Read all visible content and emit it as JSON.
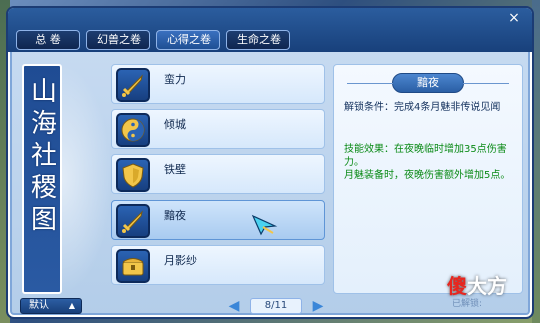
{
  "tabs": [
    {
      "label": "总  卷",
      "active": false
    },
    {
      "label": "幻兽之卷",
      "active": false
    },
    {
      "label": "心得之卷",
      "active": true
    },
    {
      "label": "生命之卷",
      "active": false
    }
  ],
  "close_icon": "×",
  "banner": {
    "text": "山海社稷图"
  },
  "list": {
    "items": [
      {
        "label": "蛮力",
        "icon": "sword-icon",
        "selected": false
      },
      {
        "label": "倾城",
        "icon": "yin-yang-icon",
        "selected": false
      },
      {
        "label": "铁壁",
        "icon": "shield-icon",
        "selected": false
      },
      {
        "label": "黯夜",
        "icon": "sword-icon",
        "selected": true
      },
      {
        "label": "月影纱",
        "icon": "chest-icon",
        "selected": false
      }
    ]
  },
  "detail": {
    "title": "黯夜",
    "unlock_text": "解锁条件：完成4条月魅非传说见闻",
    "effect_line1": "技能效果：在夜晚临时增加35点伤害力。",
    "effect_line2": "月魅装备时，夜晚伤害额外增加5点。"
  },
  "footer": {
    "default_label": "默认",
    "default_arrow": "▲",
    "page_indicator": "8/11",
    "prev_arrow": "◀",
    "next_arrow": "▶"
  },
  "watermark": {
    "red": "傻",
    "rest": "大方",
    "sub": "已解锁:"
  },
  "colors": {
    "accent": "#1c3c74",
    "effect_green": "#0a8a16",
    "watermark_red": "#e8261f"
  }
}
